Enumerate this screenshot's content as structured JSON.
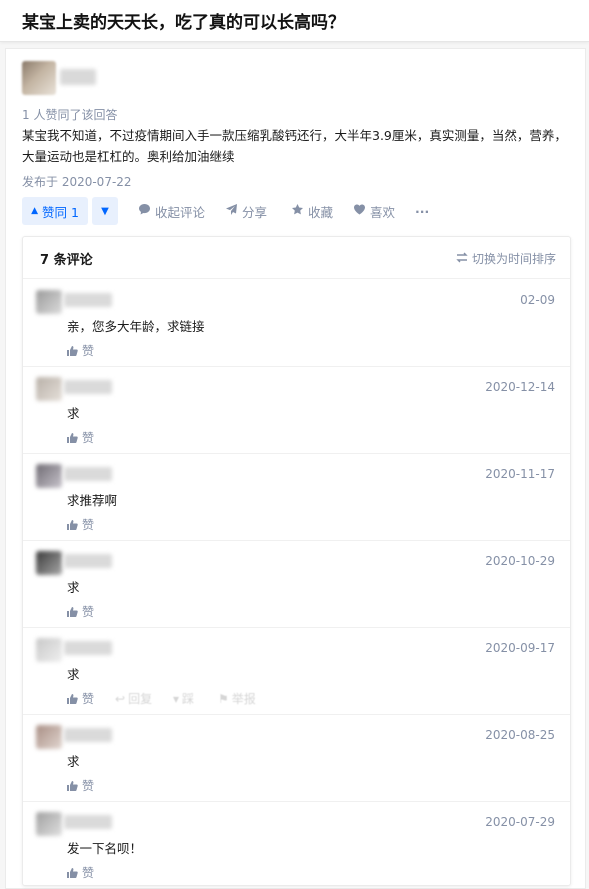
{
  "question": {
    "title": "某宝上卖的天天长，吃了真的可以长高吗？"
  },
  "answer": {
    "vote_summary": "1 人赞同了该回答",
    "text": "某宝我不知道，不过疫情期间入手一款压缩乳酸钙还行，大半年3.9厘米，真实测量，当然，营养，大量运动也是杠杠的。奥利给加油继续",
    "published": "发布于 2020-07-22"
  },
  "actions": {
    "vote_up": "赞同 1",
    "collapse_comments": "收起评论",
    "share": "分享",
    "favorite": "收藏",
    "like": "喜欢",
    "more": "···"
  },
  "comments": {
    "count_label": "7 条评论",
    "sort_label": "切换为时间排序",
    "like_label": "赞",
    "reply_label": "回复",
    "dislike_label": "踩",
    "report_label": "举报",
    "items": [
      {
        "date": "02-09",
        "text": "亲，您多大年龄，求链接"
      },
      {
        "date": "2020-12-14",
        "text": "求"
      },
      {
        "date": "2020-11-17",
        "text": "求推荐啊"
      },
      {
        "date": "2020-10-29",
        "text": "求"
      },
      {
        "date": "2020-09-17",
        "text": "求"
      },
      {
        "date": "2020-08-25",
        "text": "求"
      },
      {
        "date": "2020-07-29",
        "text": "发一下名呗！"
      }
    ]
  },
  "colors": {
    "accent": "#0066ff",
    "muted": "#8590a6",
    "vote_bg": "#e8f0fd"
  },
  "icons": [
    "thumb-up-icon",
    "chevron-down-icon",
    "comment-icon",
    "share-icon",
    "star-icon",
    "heart-icon",
    "swap-icon",
    "reply-icon",
    "thumb-down-icon",
    "flag-icon"
  ]
}
